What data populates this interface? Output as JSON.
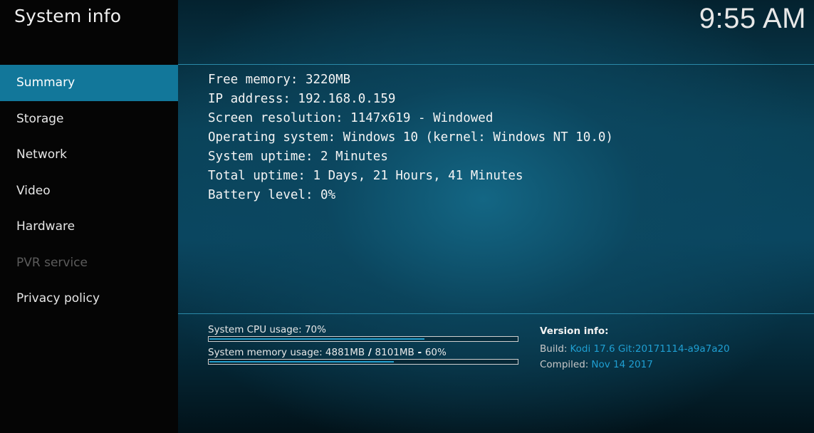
{
  "app": {
    "title": "System info",
    "clock": "9:55 AM"
  },
  "sidebar": {
    "items": [
      {
        "label": "Summary",
        "state": "active"
      },
      {
        "label": "Storage",
        "state": "normal"
      },
      {
        "label": "Network",
        "state": "normal"
      },
      {
        "label": "Video",
        "state": "normal"
      },
      {
        "label": "Hardware",
        "state": "normal"
      },
      {
        "label": "PVR service",
        "state": "disabled"
      },
      {
        "label": "Privacy policy",
        "state": "normal"
      }
    ]
  },
  "summary": {
    "lines": [
      "Free memory: 3220MB",
      "IP address: 192.168.0.159",
      "Screen resolution: 1147x619 - Windowed",
      "Operating system: Windows 10 (kernel: Windows NT 10.0)",
      "System uptime: 2 Minutes",
      "Total uptime: 1 Days, 21 Hours, 41 Minutes",
      "Battery level: 0%"
    ]
  },
  "usage": {
    "cpu": {
      "label": "System CPU usage: 70%",
      "fraction": 0.7
    },
    "memory": {
      "label_used": "System memory usage: 4881MB",
      "label_sep1": " / ",
      "label_total": "8101MB",
      "label_sep2": " - ",
      "label_percent": "60%",
      "fraction": 0.6
    }
  },
  "version": {
    "heading": "Version info:",
    "build_key": "Build:",
    "build_value": "Kodi 17.6 Git:20171114-a9a7a20",
    "compiled_key": "Compiled:",
    "compiled_value": "Nov 14 2017"
  },
  "colors": {
    "accent": "#12779a",
    "bar_fill": "#24a0cf",
    "link_value": "#1f9fd2",
    "divider": "#2a89a8",
    "disabled_text": "#5c5c5c"
  }
}
